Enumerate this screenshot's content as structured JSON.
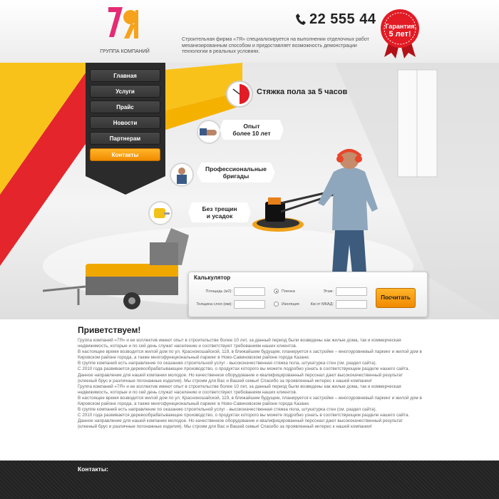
{
  "brand": {
    "logo_mark": "7я",
    "subtitle": "ГРУППА КОМПАНИЙ"
  },
  "header": {
    "phone": "22 555 44",
    "about": "Строительная фирма «7Я» специализируется на выполнении отделочных работ механизированным способом и предоставляет возможность демонстрации технологии в реальных условиях.",
    "badge_line1": "Гарантия",
    "badge_line2": "5 лет!"
  },
  "menu": {
    "items": [
      {
        "label": "Главная"
      },
      {
        "label": "Услуги"
      },
      {
        "label": "Прайс"
      },
      {
        "label": "Новости"
      },
      {
        "label": "Партнерам"
      },
      {
        "label": "Контакты"
      }
    ],
    "active_index": 5
  },
  "hero": {
    "headline": "Стяжка пола за 5 часов",
    "features": [
      {
        "line1": "Опыт",
        "line2": "более 10 лет",
        "icon": "handshake-icon"
      },
      {
        "line1": "Профессиональные",
        "line2": "бригады",
        "icon": "worker-icon"
      },
      {
        "line1": "Без трещин",
        "line2": "и усадок",
        "icon": "tape-measure-icon"
      }
    ]
  },
  "calculator": {
    "title": "Калькулятор",
    "area_label": "Площадь (м2):",
    "thickness_label": "Толщина слоя (мм):",
    "film_label": "Пленка",
    "insulation_label": "Изоляция",
    "floor_label": "Этаж:",
    "km_label": "Км от МКАД:",
    "button": "Посчитать"
  },
  "content": {
    "greeting": "Приветствуем!",
    "paragraphs": [
      "Группа компаний «7Я» и ее коллектив имеют опыт в строительстве более 10 лет, за данный период были возведены как жилые дома, так и коммерческая недвижимость, которые и по сей день служат населению и соответствуют требованиям наших клиентов.",
      "В настоящее время возводится жилой дом по ул. Краснокошайской, 119, в ближайшем будущем, планируется к застройке – многоуровневый паркинг и жилой дом в Кировском районе города, а также многофункциональный паркинг в Ново-Савиновском районе города Казани.",
      "В группе компаний есть направление по оказанию строительной услуг - высококачественная стяжка пола, штукатурка стен (см. раздел сайта).",
      "С 2010 года развивается деревообрабатывающее производство, о продуктах которого вы можете подробно узнать в соответствующем разделе нашего сайта. Данное направление для нашей компании молодое. Но качественное оборудование и квалифицированный персонал дают высококачественный результат (клееный брус и различные погонажные изделия). Мы строим для Вас и Вашей семьи! Спасибо за проявленный интерес к нашей компании!",
      "Группа компаний «7Я» и ее коллектив имеют опыт в строительстве более 10 лет, за данный период были возведены как жилые дома, так и коммерческая недвижимость, которые и по сей день служат населению и соответствуют требованиям наших клиентов.",
      "В настоящее время возводится жилой дом по ул. Краснокошайской, 119, в ближайшем будущем, планируется к застройке – многоуровневый паркинг и жилой дом в Кировском районе города, а также многофункциональный паркинг в Ново-Савиновском районе города Казани.",
      "В группе компаний есть направление по оказанию строительной услуг - высококачественная стяжка пола, штукатурка стен (см. раздел сайта).",
      "С 2010 года развивается деревообрабатывающее производство, о продуктах которого вы можете подробно узнать в соответствующем разделе нашего сайта. Данное направление для нашей компании молодое. Но качественное оборудование и квалифицированный персонал дают высококачественный результат (клееный брус и различные погонажные изделия). Мы строим для Вас и Вашей семьи! Спасибо за проявленный интерес к нашей компании!"
    ]
  },
  "footer": {
    "contacts_title": "Контакты:"
  },
  "colors": {
    "accent_orange": "#f5a000",
    "red": "#e0202a",
    "yellow": "#f8c21a",
    "menu_dark": "#2b2b2b"
  }
}
